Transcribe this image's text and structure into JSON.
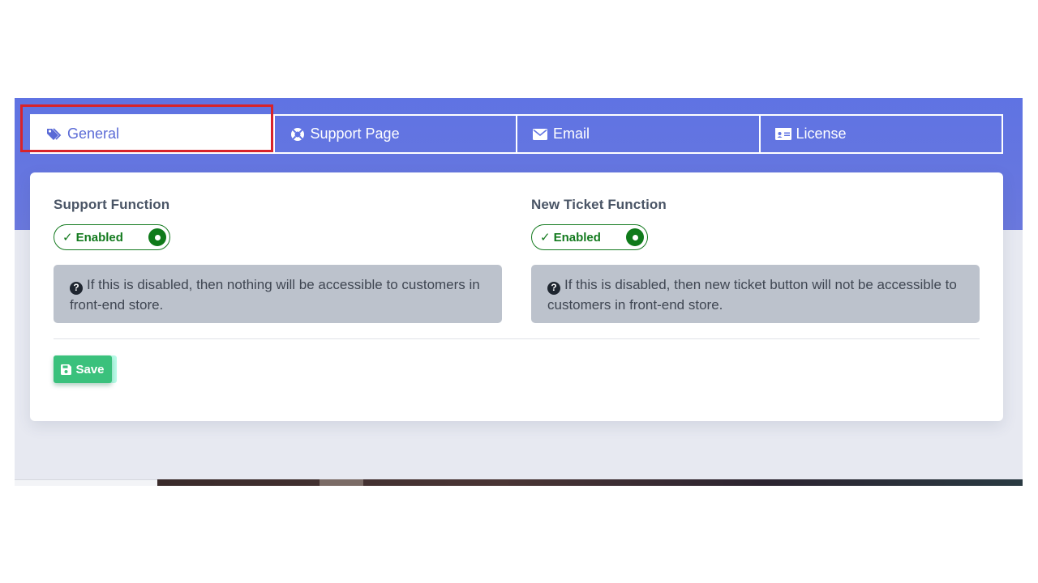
{
  "tabs": [
    {
      "label": "General",
      "icon": "tags-icon",
      "active": true
    },
    {
      "label": "Support Page",
      "icon": "life-ring-icon",
      "active": false
    },
    {
      "label": "Email",
      "icon": "envelope-icon",
      "active": false
    },
    {
      "label": "License",
      "icon": "id-card-icon",
      "active": false
    }
  ],
  "settings": {
    "support_function": {
      "label": "Support Function",
      "toggle_check": "✓",
      "toggle_state": "Enabled",
      "info_icon": "?",
      "info_text": "If this is disabled, then nothing will be accessible to customers in front-end store."
    },
    "new_ticket_function": {
      "label": "New Ticket Function",
      "toggle_check": "✓",
      "toggle_state": "Enabled",
      "info_icon": "?",
      "info_text": "If this is disabled, then new ticket button will not be accessible to customers in front-end store."
    }
  },
  "actions": {
    "save_label": "Save",
    "save_icon": "floppy-disk-icon"
  },
  "colors": {
    "accent": "#5f73e3",
    "active_tab_text": "#5a6ad6",
    "toggle_green": "#137a1e",
    "save_green": "#3ac17c",
    "info_bg": "#bcc2cc",
    "highlight_red": "#d8232a"
  }
}
